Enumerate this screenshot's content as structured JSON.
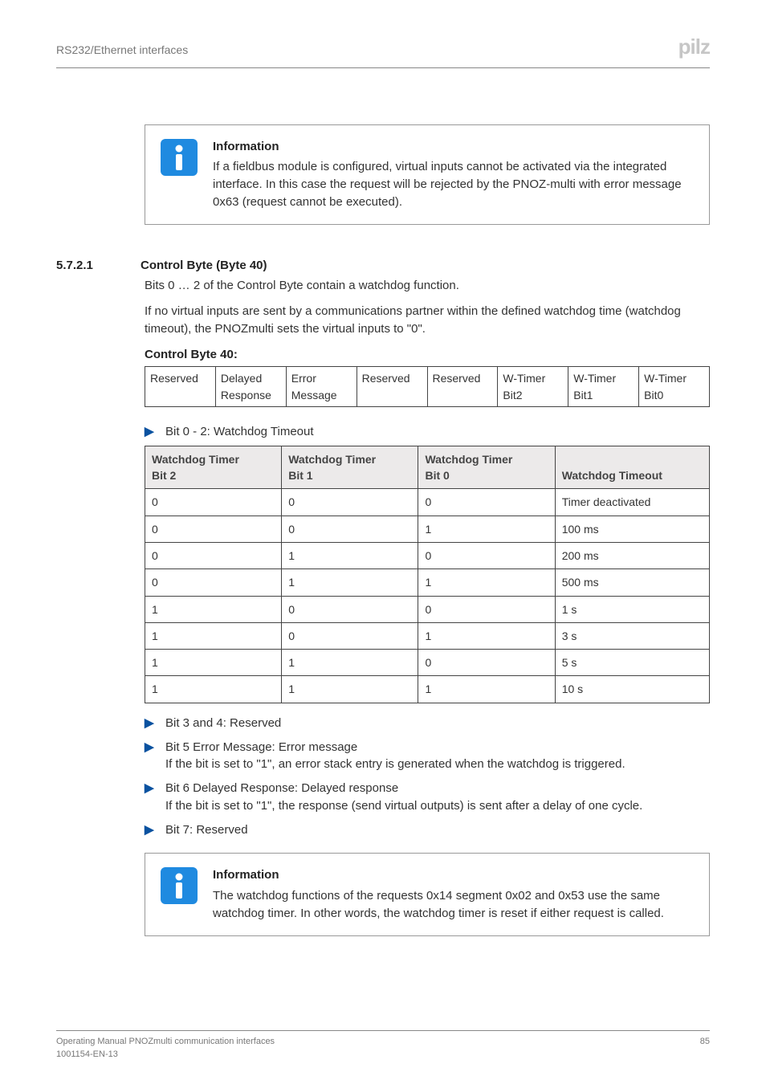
{
  "header": {
    "title": "RS232/Ethernet interfaces",
    "logo": "pilz"
  },
  "info1": {
    "heading": "Information",
    "body": "If a fieldbus module is configured, virtual inputs cannot be activated via the integrated interface. In this case the request will be rejected by the PNOZ-multi with error message 0x63 (request cannot be executed)."
  },
  "section": {
    "num": "5.7.2.1",
    "title": "Control Byte (Byte 40)",
    "p1": "Bits 0 … 2 of the Control Byte contain a watchdog function.",
    "p2": "If no virtual inputs are sent by a communications partner within the defined watchdog time (watchdog timeout), the PNOZmulti sets the virtual inputs to \"0\".",
    "cb_label": "Control Byte 40:"
  },
  "ctrlbyte": {
    "c0": "Reserved",
    "c1a": "Delayed",
    "c1b": "Response",
    "c2a": "Error",
    "c2b": "Message",
    "c3": "Reserved",
    "c4": "Reserved",
    "c5a": "W-Timer",
    "c5b": "Bit2",
    "c6a": "W-Timer",
    "c6b": "Bit1",
    "c7a": "W-Timer",
    "c7b": "Bit0"
  },
  "bullets": {
    "wdt_intro": "Bit 0 - 2: Watchdog Timeout",
    "b3": "Bit 3 and 4: Reserved",
    "b5_l1": "Bit 5 Error Message: Error message",
    "b5_l2": "If the bit is set to \"1\", an error stack entry is generated when the watchdog is triggered.",
    "b6_l1": "Bit 6 Delayed Response: Delayed response",
    "b6_l2": "If the bit is set to \"1\", the response (send virtual outputs) is sent after a delay of one cycle.",
    "b7": "Bit 7: Reserved"
  },
  "chart_data": {
    "type": "table",
    "title": "Watchdog Timeout truth table",
    "columns": [
      "Watchdog Timer Bit 2",
      "Watchdog Timer Bit 1",
      "Watchdog Timer Bit 0",
      "Watchdog Timeout"
    ],
    "rows": [
      [
        "0",
        "0",
        "0",
        "Timer deactivated"
      ],
      [
        "0",
        "0",
        "1",
        "100 ms"
      ],
      [
        "0",
        "1",
        "0",
        "200 ms"
      ],
      [
        "0",
        "1",
        "1",
        "500 ms"
      ],
      [
        "1",
        "0",
        "0",
        "1 s"
      ],
      [
        "1",
        "0",
        "1",
        "3 s"
      ],
      [
        "1",
        "1",
        "0",
        "5 s"
      ],
      [
        "1",
        "1",
        "1",
        "10 s"
      ]
    ],
    "header_top": {
      "h1": "Watchdog Timer",
      "h2": "Watchdog Timer",
      "h3": "Watchdog Timer"
    },
    "header_bot": {
      "h1": "Bit 2",
      "h2": "Bit 1",
      "h3": "Bit 0",
      "h4": "Watchdog Timeout"
    }
  },
  "info2": {
    "heading": "Information",
    "body": "The watchdog functions of the requests 0x14 segment 0x02 and 0x53 use the same watchdog timer. In other words, the watchdog timer is reset if either request is called."
  },
  "footer": {
    "l1": "Operating Manual PNOZmulti communication interfaces",
    "l2": "1001154-EN-13",
    "page": "85"
  }
}
